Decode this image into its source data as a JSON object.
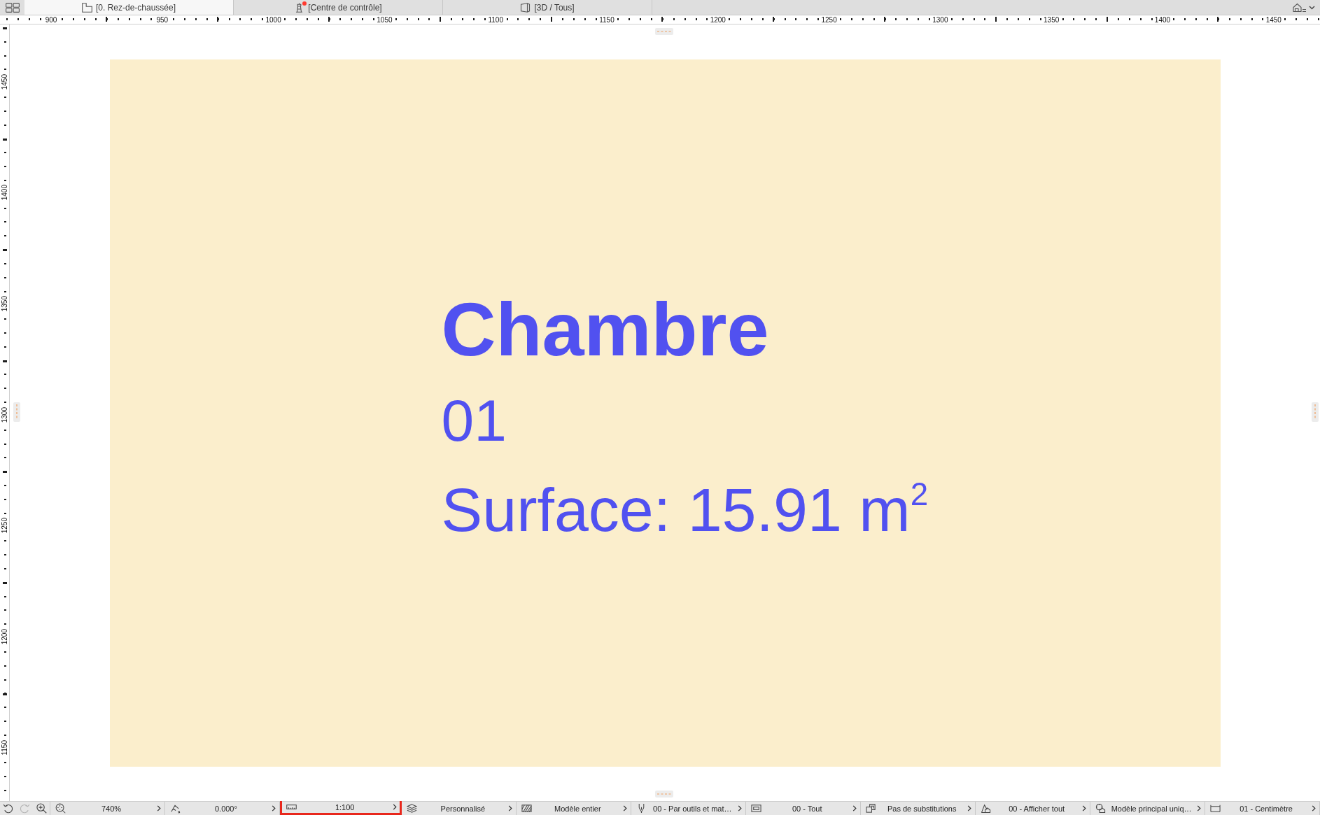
{
  "top_bar": {
    "tabs": [
      {
        "kind": "plan",
        "label": "[0. Rez-de-chaussée]",
        "selected": true,
        "alert": false
      },
      {
        "kind": "control",
        "label": "[Centre de contrôle]",
        "selected": false,
        "alert": true
      },
      {
        "kind": "model",
        "label": "[3D / Tous]",
        "selected": false,
        "alert": false
      }
    ]
  },
  "horizontal_ruler": {
    "labels": [
      "900",
      "950",
      "1000",
      "1050",
      "1100",
      "1150",
      "1200",
      "1250",
      "1300",
      "1350",
      "1400",
      "1450"
    ]
  },
  "vertical_ruler": {
    "labels": [
      "1450",
      "1400",
      "1350",
      "1300",
      "1250",
      "1200",
      "1150"
    ]
  },
  "room": {
    "name": "Chambre",
    "number": "01",
    "area": "Surface: 15.91 m$^{2}$"
  },
  "status_bar": {
    "tools": [
      {
        "kind": "undo",
        "disabled": false
      },
      {
        "kind": "redo",
        "disabled": true
      },
      {
        "kind": "zoom_in",
        "disabled": false
      }
    ],
    "items": [
      {
        "kind": "zoom",
        "value": "740%",
        "highlighted": false
      },
      {
        "kind": "angle",
        "value": "0.000°",
        "highlighted": false
      },
      {
        "kind": "scale",
        "value": "1:100",
        "highlighted": true
      },
      {
        "kind": "layers",
        "value": "Personnalisé",
        "highlighted": false
      },
      {
        "kind": "model_filter",
        "value": "Modèle entier",
        "highlighted": false
      },
      {
        "kind": "pens",
        "value": "00 - Par outils et mat…",
        "highlighted": false
      },
      {
        "kind": "structure",
        "value": "00 - Tout",
        "highlighted": false
      },
      {
        "kind": "overrides",
        "value": "Pas de substitutions",
        "highlighted": false
      },
      {
        "kind": "renovation",
        "value": "00 - Afficher tout",
        "highlighted": false
      },
      {
        "kind": "model_view",
        "value": "Modèle principal uniq…",
        "highlighted": false
      },
      {
        "kind": "dimensions",
        "value": "01 - Centimètre",
        "highlighted": false
      }
    ]
  }
}
